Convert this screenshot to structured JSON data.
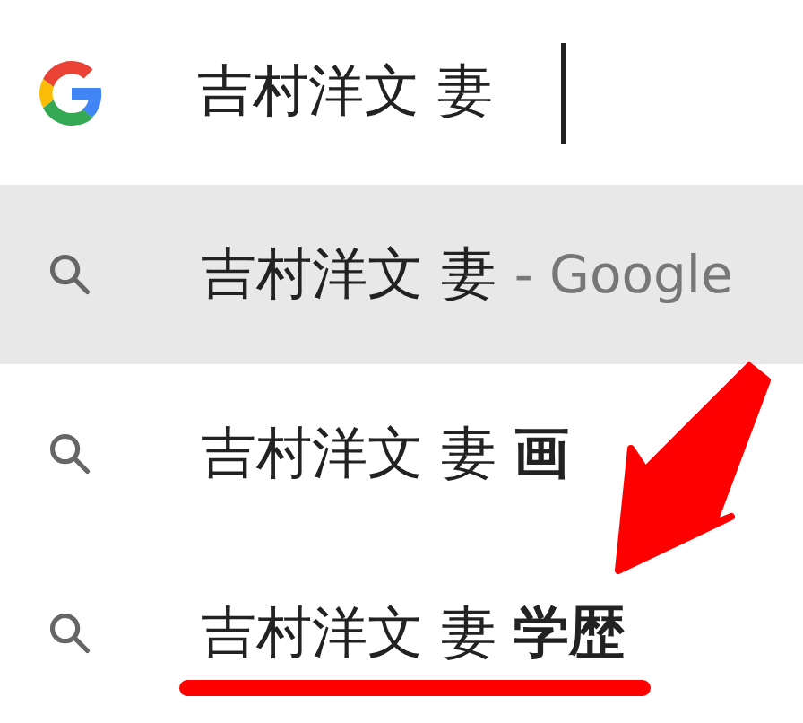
{
  "search": {
    "value": "吉村洋文 妻"
  },
  "suggestions": [
    {
      "query": "吉村洋文 妻",
      "suffix": "- Google",
      "selected": true,
      "underlined": false
    },
    {
      "query": "吉村洋文 妻 **画**",
      "selected": false,
      "underlined": false
    },
    {
      "query": "吉村洋文 妻 **学歴**",
      "selected": false,
      "underlined": true
    }
  ],
  "annotation": {
    "kind": "arrow"
  }
}
